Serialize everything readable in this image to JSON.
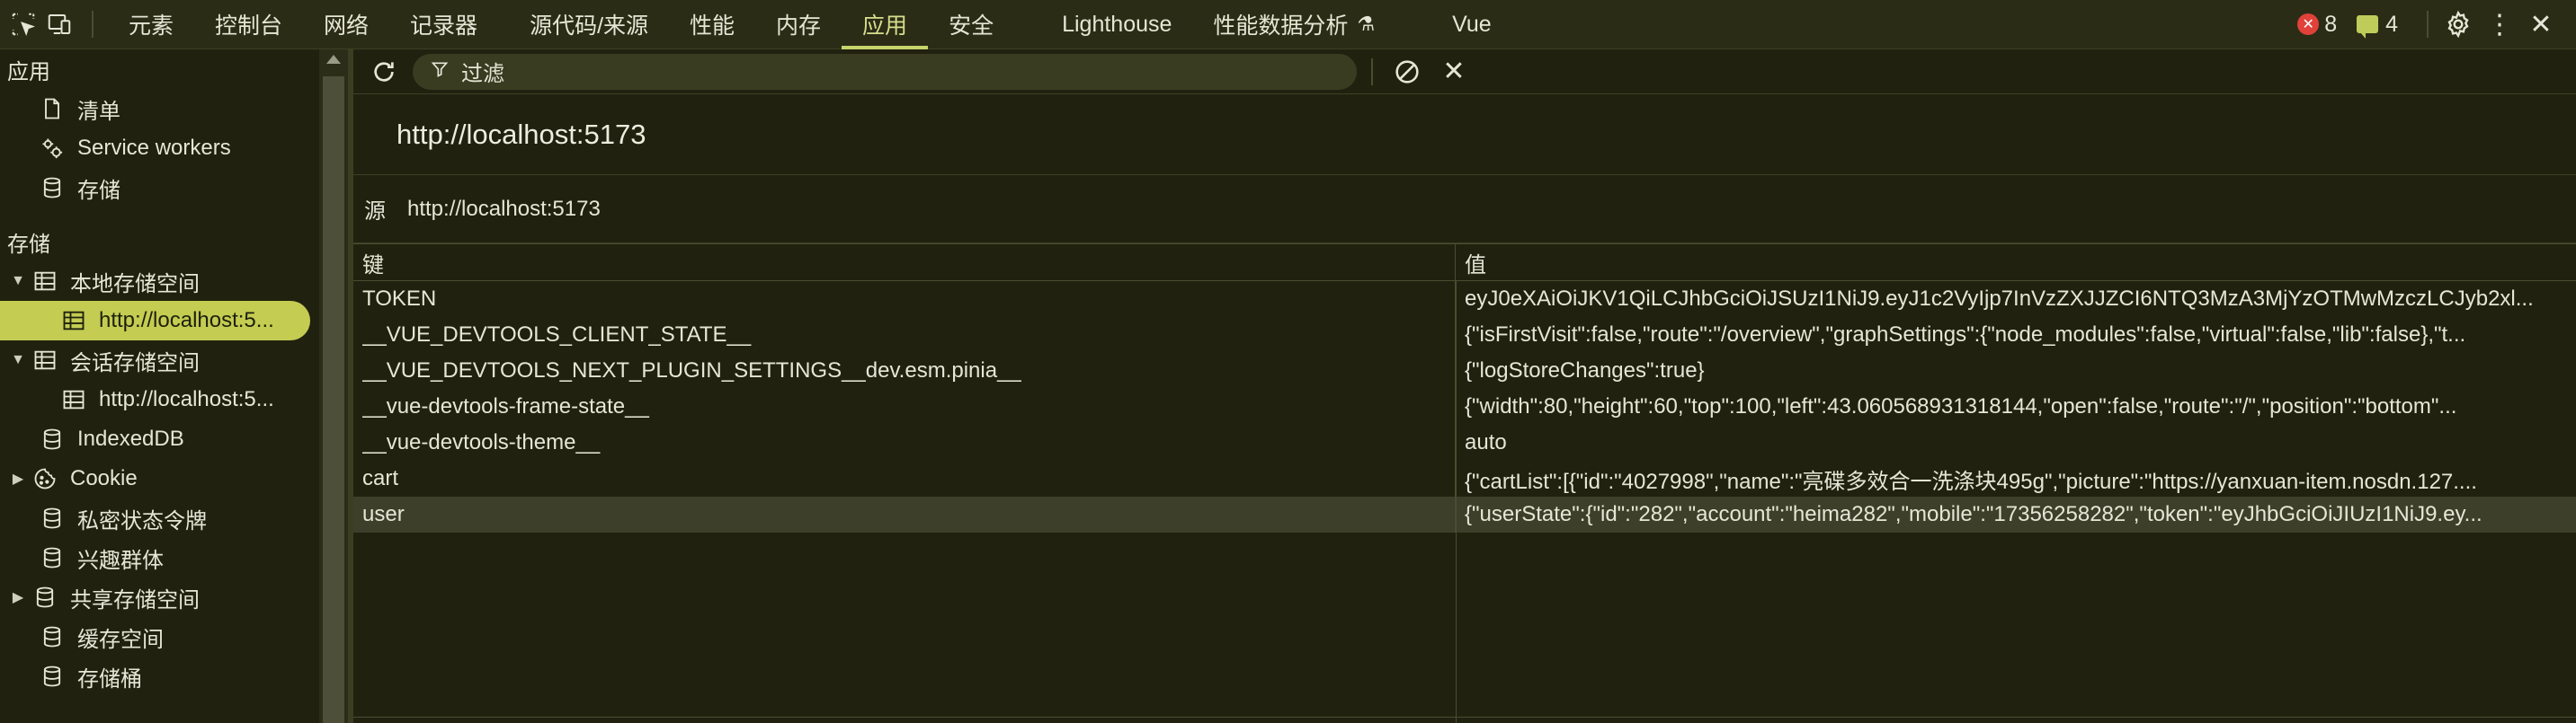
{
  "topbar": {
    "tabs": [
      {
        "label": "元素",
        "active": false
      },
      {
        "label": "控制台",
        "active": false
      },
      {
        "label": "网络",
        "active": false
      },
      {
        "label": "记录器",
        "active": false
      },
      {
        "label": "源代码/来源",
        "active": false
      },
      {
        "label": "性能",
        "active": false
      },
      {
        "label": "内存",
        "active": false
      },
      {
        "label": "应用",
        "active": true
      },
      {
        "label": "安全",
        "active": false
      },
      {
        "label": "Lighthouse",
        "active": false
      },
      {
        "label": "性能数据分析",
        "active": false
      },
      {
        "label": "Vue",
        "active": false
      }
    ],
    "error_count": "8",
    "message_count": "4"
  },
  "sidebar": {
    "app_heading": "应用",
    "app_items": [
      {
        "label": "清单",
        "icon": "file-icon"
      },
      {
        "label": "Service workers",
        "icon": "gears-icon"
      },
      {
        "label": "存储",
        "icon": "database-icon"
      }
    ],
    "storage_heading": "存储",
    "storage_items": {
      "local_storage": "本地存储空间",
      "local_origin": "http://localhost:5...",
      "session_storage": "会话存储空间",
      "session_origin": "http://localhost:5...",
      "indexeddb": "IndexedDB",
      "cookie": "Cookie",
      "private_state_tokens": "私密状态令牌",
      "interest_groups": "兴趣群体",
      "shared_storage": "共享存储空间",
      "cache_storage": "缓存空间",
      "storage_buckets": "存储桶"
    }
  },
  "main": {
    "filter_placeholder": "过滤",
    "origin_title": "http://localhost:5173",
    "source_label": "源",
    "source_value": "http://localhost:5173",
    "table": {
      "headers": {
        "key": "键",
        "value": "值"
      },
      "rows": [
        {
          "key": "TOKEN",
          "value": "eyJ0eXAiOiJKV1QiLCJhbGciOiJSUzI1NiJ9.eyJ1c2VyIjp7InVzZXJJZCI6NTQ3MzA3MjYzOTMwMzczLCJyb2xl..."
        },
        {
          "key": "__VUE_DEVTOOLS_CLIENT_STATE__",
          "value": "{\"isFirstVisit\":false,\"route\":\"/overview\",\"graphSettings\":{\"node_modules\":false,\"virtual\":false,\"lib\":false},\"t..."
        },
        {
          "key": "__VUE_DEVTOOLS_NEXT_PLUGIN_SETTINGS__dev.esm.pinia__",
          "value": "{\"logStoreChanges\":true}"
        },
        {
          "key": "__vue-devtools-frame-state__",
          "value": "{\"width\":80,\"height\":60,\"top\":100,\"left\":43.060568931318144,\"open\":false,\"route\":\"/\",\"position\":\"bottom\"..."
        },
        {
          "key": "__vue-devtools-theme__",
          "value": "auto"
        },
        {
          "key": "cart",
          "value": "{\"cartList\":[{\"id\":\"4027998\",\"name\":\"亮碟多效合一洗涤块495g\",\"picture\":\"https://yanxuan-item.nosdn.127...."
        },
        {
          "key": "user",
          "value": "{\"userState\":{\"id\":\"282\",\"account\":\"heima282\",\"mobile\":\"17356258282\",\"token\":\"eyJhbGciOiJIUzI1NiJ9.ey..."
        }
      ],
      "selected_row": 6
    }
  },
  "colors": {
    "accent": "#c7d36b",
    "background": "#20220f",
    "error": "#e0413a"
  }
}
